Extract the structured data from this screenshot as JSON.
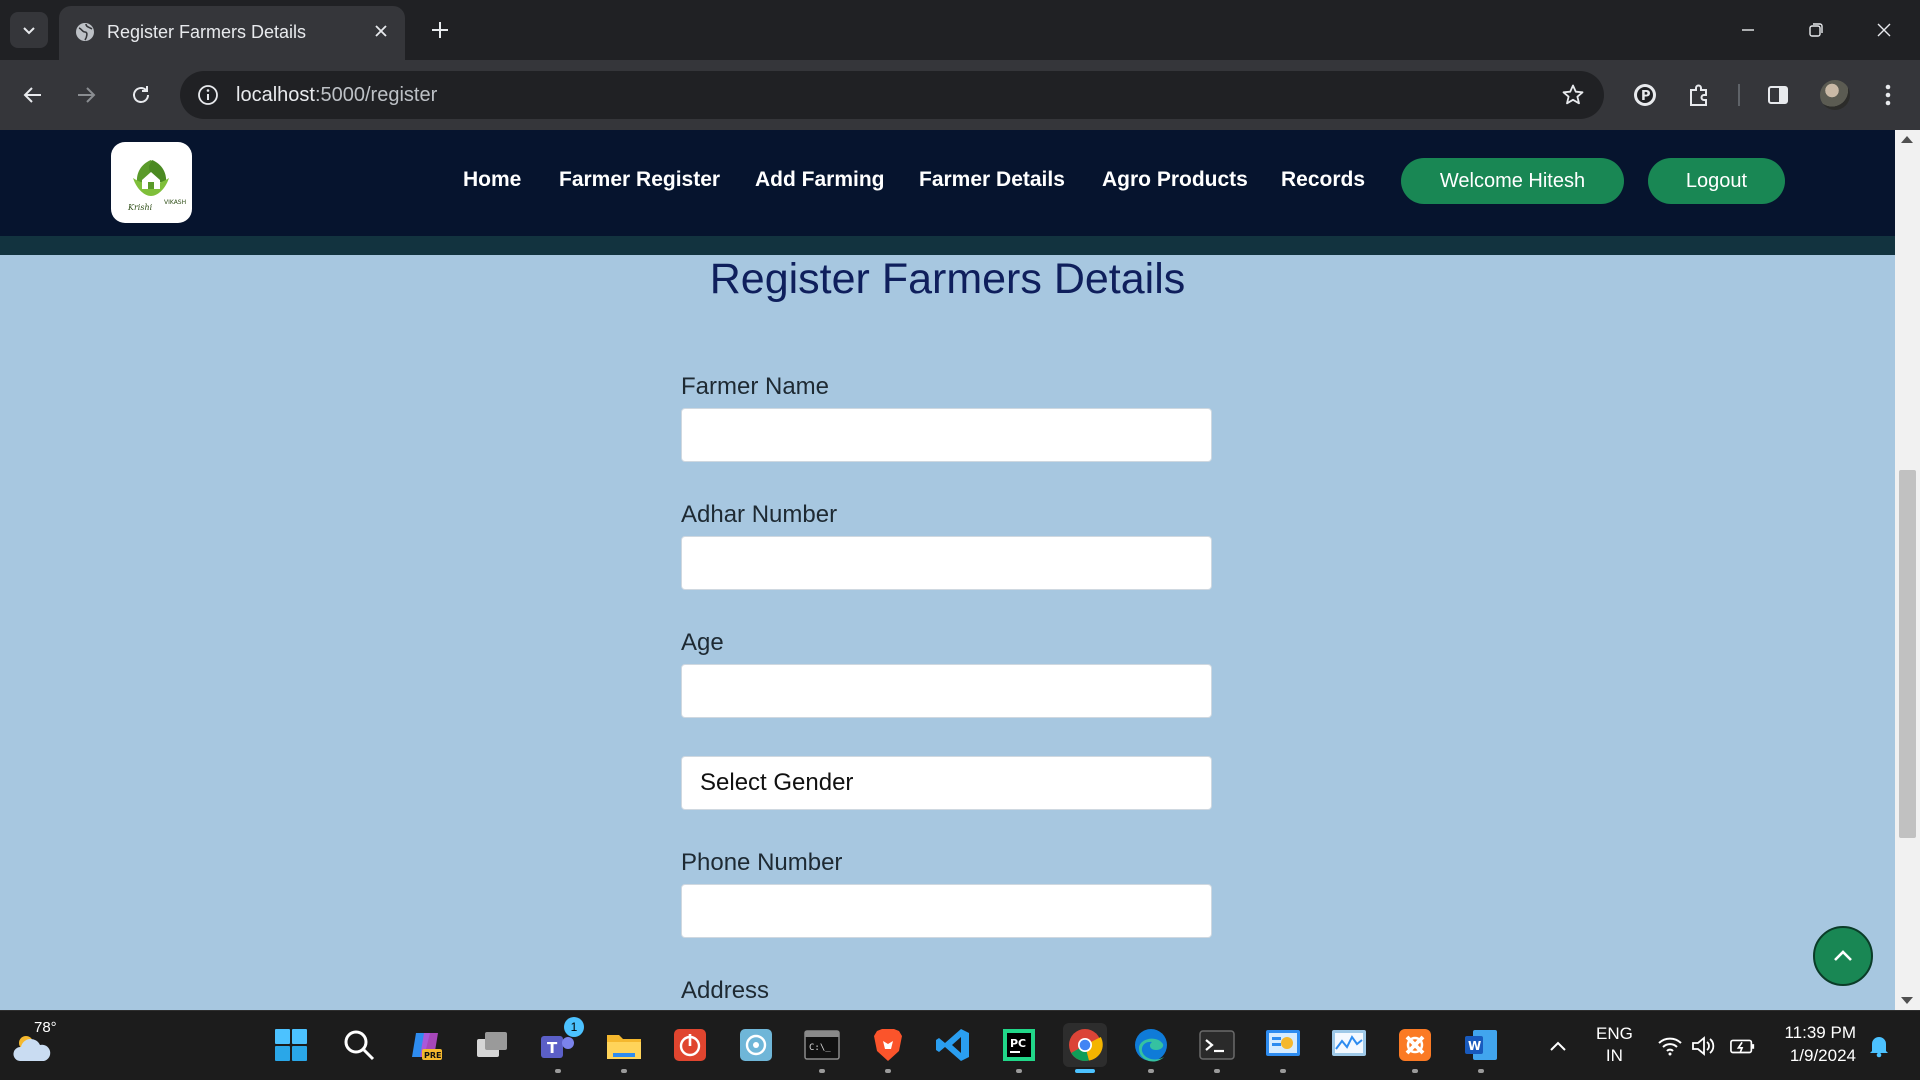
{
  "browser": {
    "tab_title": "Register Farmers Details",
    "url_host": "localhost",
    "url_path": ":5000/register"
  },
  "navbar": {
    "links": [
      "Home",
      "Farmer Register",
      "Add Farming",
      "Farmer Details",
      "Agro Products",
      "Records"
    ],
    "welcome_label": "Welcome Hitesh",
    "logout_label": "Logout",
    "accent_color": "#198754",
    "bg_color": "#06142e"
  },
  "form": {
    "title": "Register Farmers Details",
    "farmer_name_label": "Farmer Name",
    "adhar_label": "Adhar Number",
    "age_label": "Age",
    "gender_select": "Select Gender",
    "phone_label": "Phone Number",
    "address_label": "Address"
  },
  "taskbar": {
    "weather_temp": "78°",
    "teams_badge": "1",
    "lang_1": "ENG",
    "lang_2": "IN",
    "time": "11:39 PM",
    "date": "1/9/2024"
  }
}
